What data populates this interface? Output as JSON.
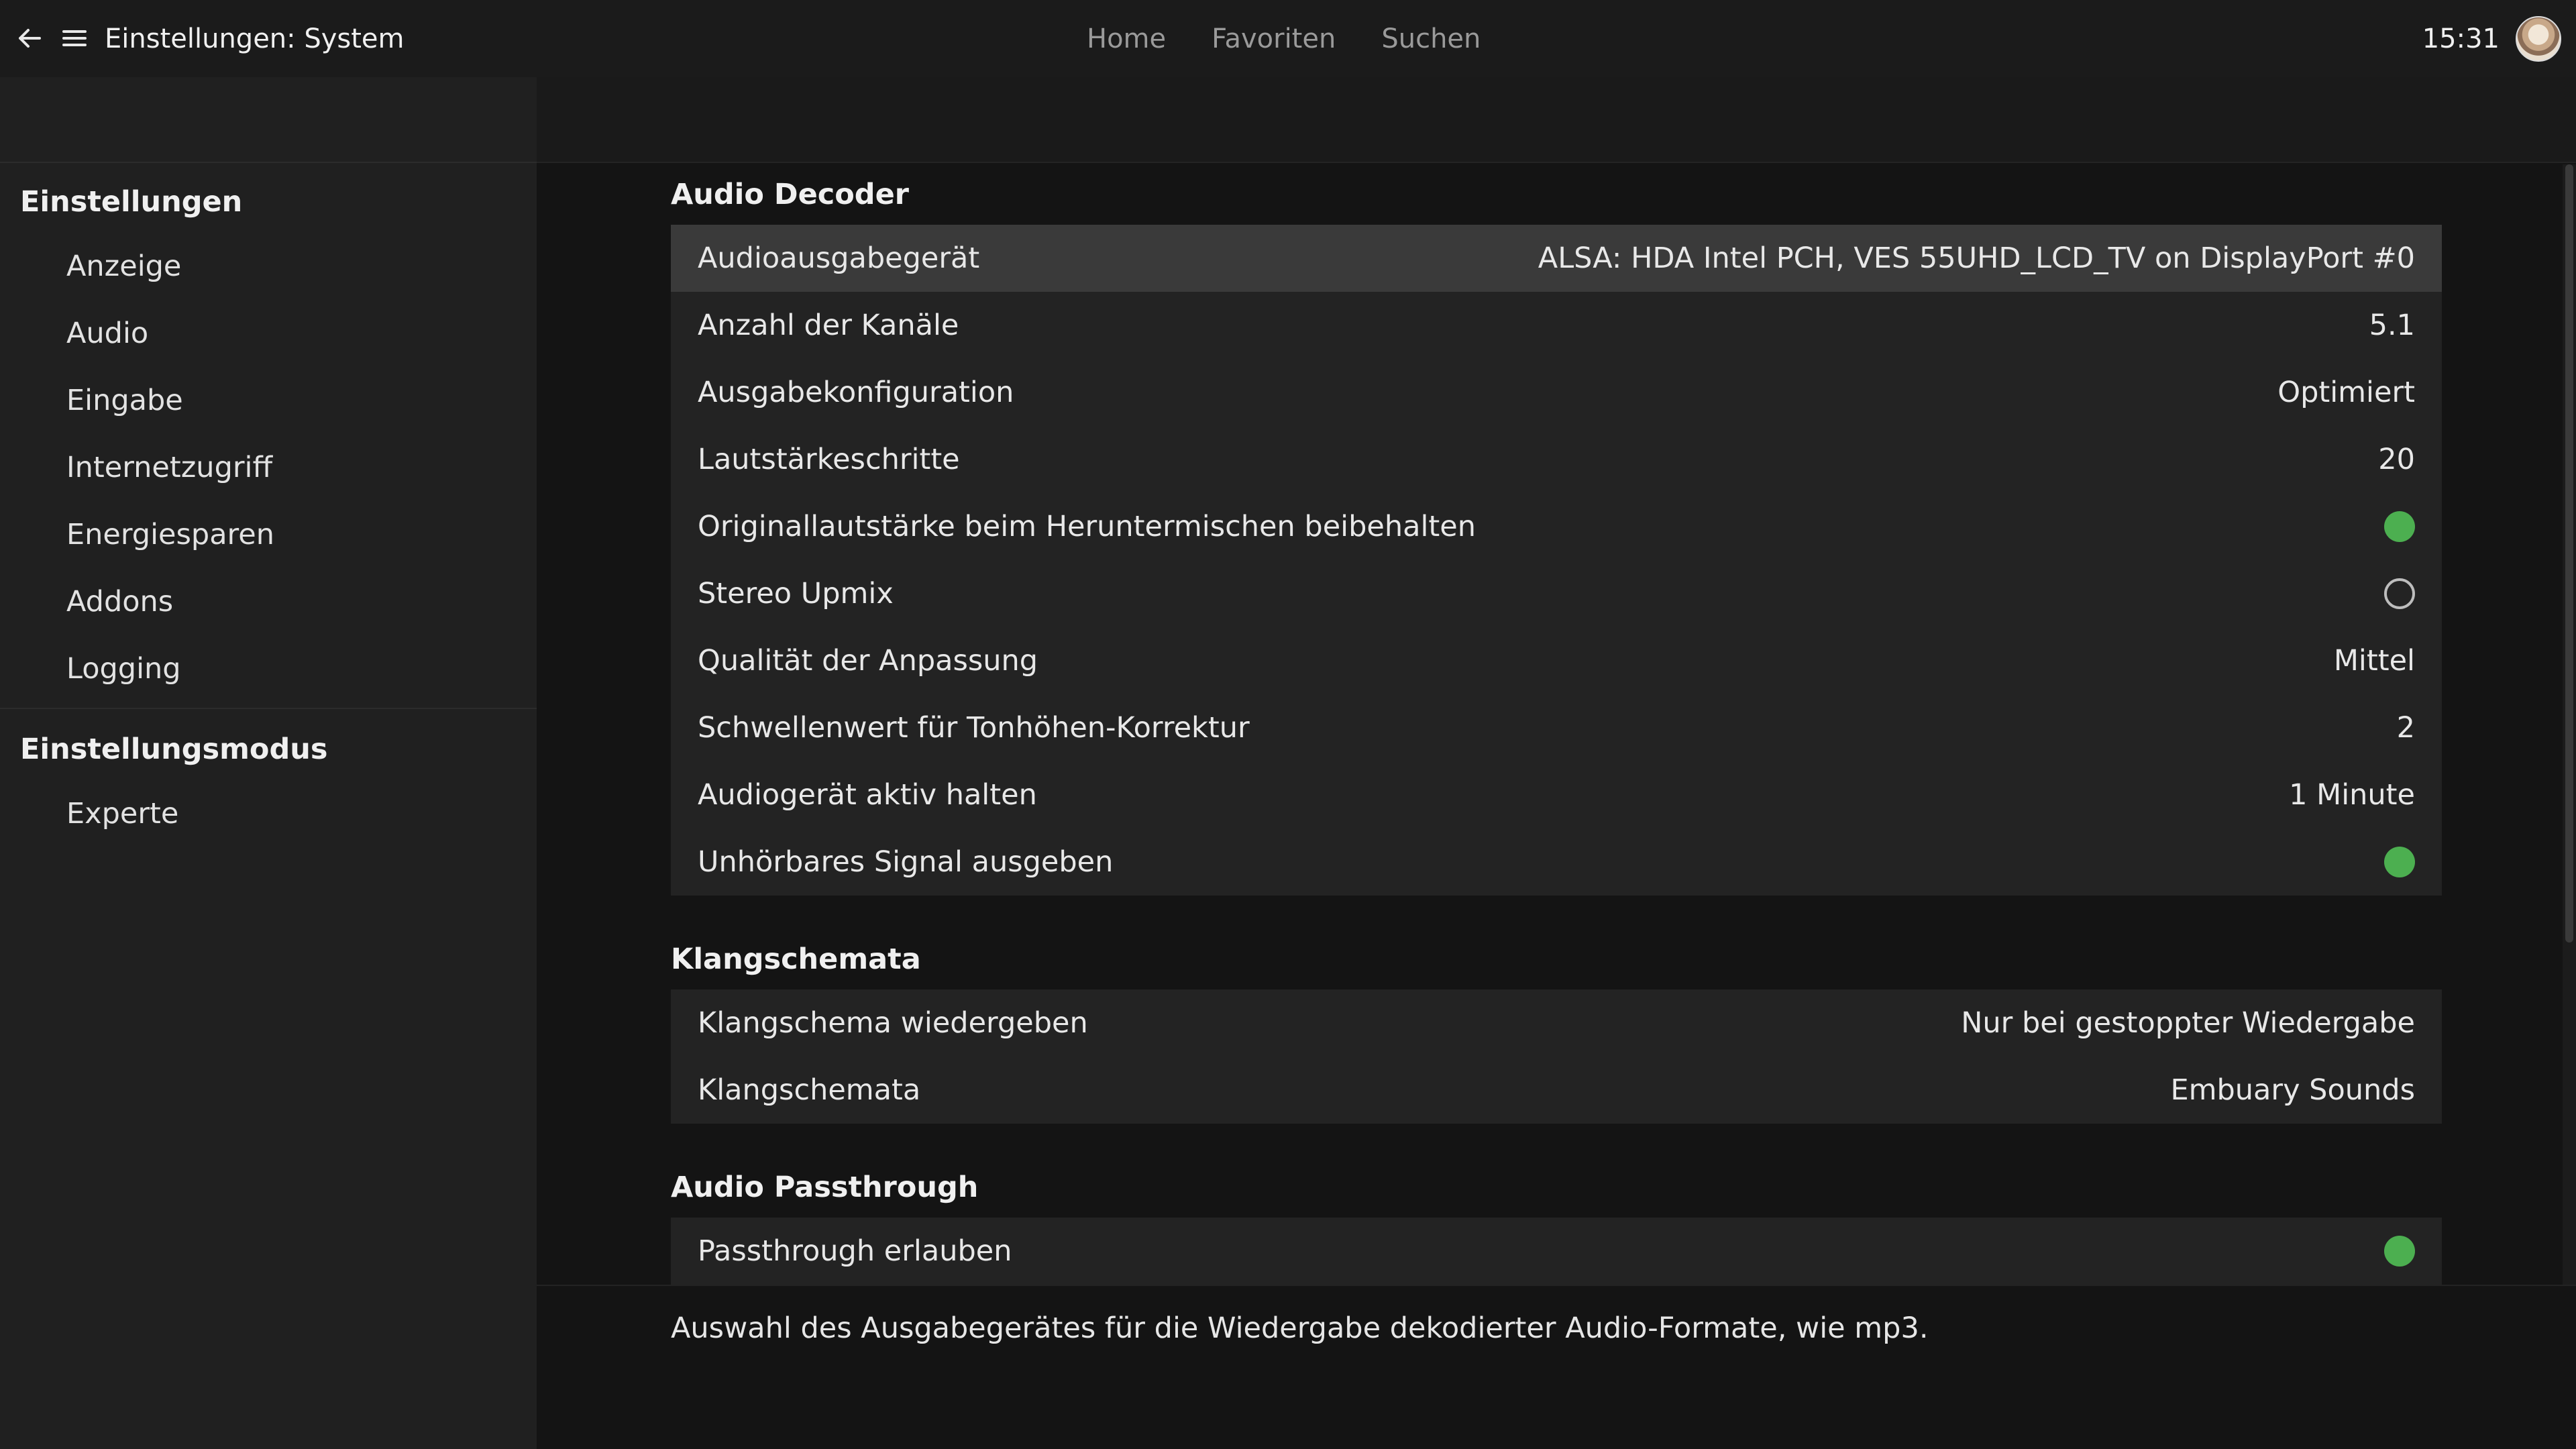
{
  "header": {
    "title": "Einstellungen: System",
    "nav": [
      "Home",
      "Favoriten",
      "Suchen"
    ],
    "clock": "15:31"
  },
  "sidebar": {
    "groups": [
      {
        "heading": "Einstellungen",
        "items": [
          "Anzeige",
          "Audio",
          "Eingabe",
          "Internetzugriff",
          "Energiesparen",
          "Addons",
          "Logging"
        ]
      },
      {
        "heading": "Einstellungsmodus",
        "items": [
          "Experte"
        ]
      }
    ]
  },
  "sections": [
    {
      "title": "Audio Decoder",
      "rows": [
        {
          "label": "Audioausgabegerät",
          "value": "ALSA: HDA Intel PCH, VES 55UHD_LCD_TV on DisplayPort #0",
          "selected": true
        },
        {
          "label": "Anzahl der Kanäle",
          "value": "5.1"
        },
        {
          "label": "Ausgabekonfiguration",
          "value": "Optimiert"
        },
        {
          "label": "Lautstärkeschritte",
          "value": "20"
        },
        {
          "label": "Originallautstärke beim Heruntermischen beibehalten",
          "toggle": true
        },
        {
          "label": "Stereo Upmix",
          "toggle": false
        },
        {
          "label": "Qualität der Anpassung",
          "value": "Mittel"
        },
        {
          "label": "Schwellenwert für Tonhöhen-Korrektur",
          "value": "2"
        },
        {
          "label": "Audiogerät aktiv halten",
          "value": "1 Minute"
        },
        {
          "label": "Unhörbares Signal ausgeben",
          "toggle": true
        }
      ]
    },
    {
      "title": "Klangschemata",
      "rows": [
        {
          "label": "Klangschema wiedergeben",
          "value": "Nur bei gestoppter Wiedergabe"
        },
        {
          "label": "Klangschemata",
          "value": "Embuary Sounds"
        }
      ]
    },
    {
      "title": "Audio Passthrough",
      "rows": [
        {
          "label": "Passthrough erlauben",
          "toggle": true
        }
      ]
    }
  ],
  "info": "Auswahl des Ausgabegerätes für die Wiedergabe dekodierter Audio-Formate, wie mp3.",
  "colors": {
    "toggle_on": "#4caf50",
    "selected_row": "#3a3a3a",
    "background": "#141414",
    "sidebar": "#202020"
  },
  "icons": {
    "back": "back-arrow-icon",
    "menu": "hamburger-menu-icon",
    "avatar": "user-avatar"
  }
}
